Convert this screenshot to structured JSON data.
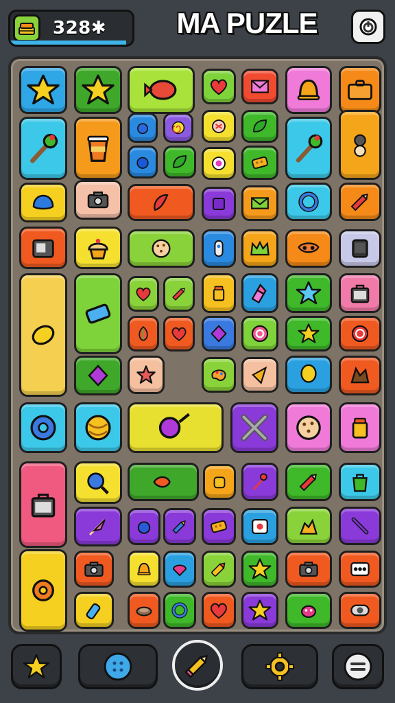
{
  "header": {
    "score": "328✱",
    "score_progress": 0.95,
    "title": "MA PUZLE",
    "score_icon": "cake-icon",
    "settings_icon": "power-icon"
  },
  "colors": {
    "background": "#3d4148",
    "board": "#7d7467",
    "accent": "#3fb4e8"
  },
  "board": {
    "tiles": [
      {
        "name": "star",
        "bg": "#2fa6e6"
      },
      {
        "name": "star",
        "bg": "#3fa82a"
      },
      {
        "name": "candy",
        "bg": "#a8e23a"
      },
      {
        "name": "heart",
        "bg": "#7ed23a"
      },
      {
        "name": "envelope",
        "bg": "#f04a30"
      },
      {
        "name": "bell",
        "bg": "#f07ad8"
      },
      {
        "name": "briefcase",
        "bg": "#f58a18"
      },
      {
        "name": "broom",
        "bg": "#3cc8e8"
      },
      {
        "name": "cup",
        "bg": "#f59a1a"
      },
      {
        "name": "pin",
        "bg": "#2a8ae0"
      },
      {
        "name": "swirl",
        "bg": "#8a5ae0"
      },
      {
        "name": "bow",
        "bg": "#f5e030"
      },
      {
        "name": "leaf",
        "bg": "#3fb82a"
      },
      {
        "name": "blue-ball",
        "bg": "#2a8ae0"
      },
      {
        "name": "leaf",
        "bg": "#3fb82a"
      },
      {
        "name": "eye",
        "bg": "#f5e030"
      },
      {
        "name": "cheese",
        "bg": "#3fb82a"
      },
      {
        "name": "broom",
        "bg": "#3cc8e8"
      },
      {
        "name": "snail",
        "bg": "#f5a51a"
      },
      {
        "name": "cushion",
        "bg": "#f5d020"
      },
      {
        "name": "camera",
        "bg": "#f5c0a8"
      },
      {
        "name": "pepper",
        "bg": "#f05a20"
      },
      {
        "name": "cube",
        "bg": "#8a3ad8"
      },
      {
        "name": "mail",
        "bg": "#f59a1a"
      },
      {
        "name": "ring",
        "bg": "#3cc8e8"
      },
      {
        "name": "pencil",
        "bg": "#f58a18"
      },
      {
        "name": "radio",
        "bg": "#f05a20"
      },
      {
        "name": "cupcake",
        "bg": "#f5e030"
      },
      {
        "name": "cookie",
        "bg": "#8ad23a"
      },
      {
        "name": "pill",
        "bg": "#2a8ae0"
      },
      {
        "name": "crown",
        "bg": "#f5a51a"
      },
      {
        "name": "mask",
        "bg": "#f58a18"
      },
      {
        "name": "phone",
        "bg": "#c8c8e8"
      },
      {
        "name": "lemon",
        "bg": "#f5d050"
      },
      {
        "name": "eraser",
        "bg": "#7ed23a"
      },
      {
        "name": "heart",
        "bg": "#8ad23a"
      },
      {
        "name": "pencil",
        "bg": "#8ad23a"
      },
      {
        "name": "jar",
        "bg": "#f5c020"
      },
      {
        "name": "lipstick",
        "bg": "#2aa0e0"
      },
      {
        "name": "blue-star",
        "bg": "#3fb82a"
      },
      {
        "name": "bag",
        "bg": "#f07aa8"
      },
      {
        "name": "onion",
        "bg": "#f05a20"
      },
      {
        "name": "heart",
        "bg": "#f05a20"
      },
      {
        "name": "gem",
        "bg": "#3a7ae0"
      },
      {
        "name": "candy-swirl",
        "bg": "#7ed23a"
      },
      {
        "name": "star",
        "bg": "#3fb82a"
      },
      {
        "name": "target",
        "bg": "#f05a20"
      },
      {
        "name": "gem",
        "bg": "#3fa82a"
      },
      {
        "name": "flower",
        "bg": "#f5c0a0"
      },
      {
        "name": "palette",
        "bg": "#8ad23a"
      },
      {
        "name": "bird",
        "bg": "#f5c0a0"
      },
      {
        "name": "balloon",
        "bg": "#2aa0e0"
      },
      {
        "name": "fox",
        "bg": "#f05a20"
      },
      {
        "name": "donut",
        "bg": "#3cc8e8"
      },
      {
        "name": "yarn",
        "bg": "#3cc8e8"
      },
      {
        "name": "pan",
        "bg": "#e8e030"
      },
      {
        "name": "cross",
        "bg": "#8a3ad8"
      },
      {
        "name": "cookie",
        "bg": "#f07ad8"
      },
      {
        "name": "jar",
        "bg": "#f07ad8"
      },
      {
        "name": "bag",
        "bg": "#f05a80"
      },
      {
        "name": "magnifier",
        "bg": "#f5e030"
      },
      {
        "name": "fish",
        "bg": "#3fa82a"
      },
      {
        "name": "toast",
        "bg": "#f5a51a"
      },
      {
        "name": "bouquet",
        "bg": "#8a3ad8"
      },
      {
        "name": "pencil",
        "bg": "#3fb82a"
      },
      {
        "name": "sack",
        "bg": "#3cc8e8"
      },
      {
        "name": "feather",
        "bg": "#8a3ad8"
      },
      {
        "name": "berry",
        "bg": "#8a3ad8"
      },
      {
        "name": "brush",
        "bg": "#8a3ad8"
      },
      {
        "name": "cheese",
        "bg": "#8a3ad8"
      },
      {
        "name": "game",
        "bg": "#2aa0e0"
      },
      {
        "name": "dog",
        "bg": "#8ad23a"
      },
      {
        "name": "baton",
        "bg": "#8a3ad8"
      },
      {
        "name": "gear",
        "bg": "#f5d020"
      },
      {
        "name": "camera",
        "bg": "#f05a20"
      },
      {
        "name": "bell",
        "bg": "#f5e030"
      },
      {
        "name": "slice",
        "bg": "#2aa0e0"
      },
      {
        "name": "marker",
        "bg": "#8ad23a"
      },
      {
        "name": "star",
        "bg": "#3fb82a"
      },
      {
        "name": "camera",
        "bg": "#f05a20"
      },
      {
        "name": "dice",
        "bg": "#f05a20"
      },
      {
        "name": "bottle",
        "bg": "#f5d020"
      },
      {
        "name": "bowl",
        "bg": "#f05a20"
      },
      {
        "name": "ring",
        "bg": "#3fb82a"
      },
      {
        "name": "heart",
        "bg": "#f05a20"
      },
      {
        "name": "star",
        "bg": "#8a3ad8"
      },
      {
        "name": "bug",
        "bg": "#3fb82a"
      },
      {
        "name": "tape",
        "bg": "#f05a20"
      },
      {
        "name": "cake",
        "bg": "#f05a20"
      }
    ]
  },
  "bottom_bar": {
    "buttons": [
      {
        "icon": "star-icon"
      },
      {
        "icon": "button-icon"
      },
      {
        "icon": "pencil-icon"
      },
      {
        "icon": "gear-icon"
      },
      {
        "icon": "menu-icon"
      }
    ]
  }
}
